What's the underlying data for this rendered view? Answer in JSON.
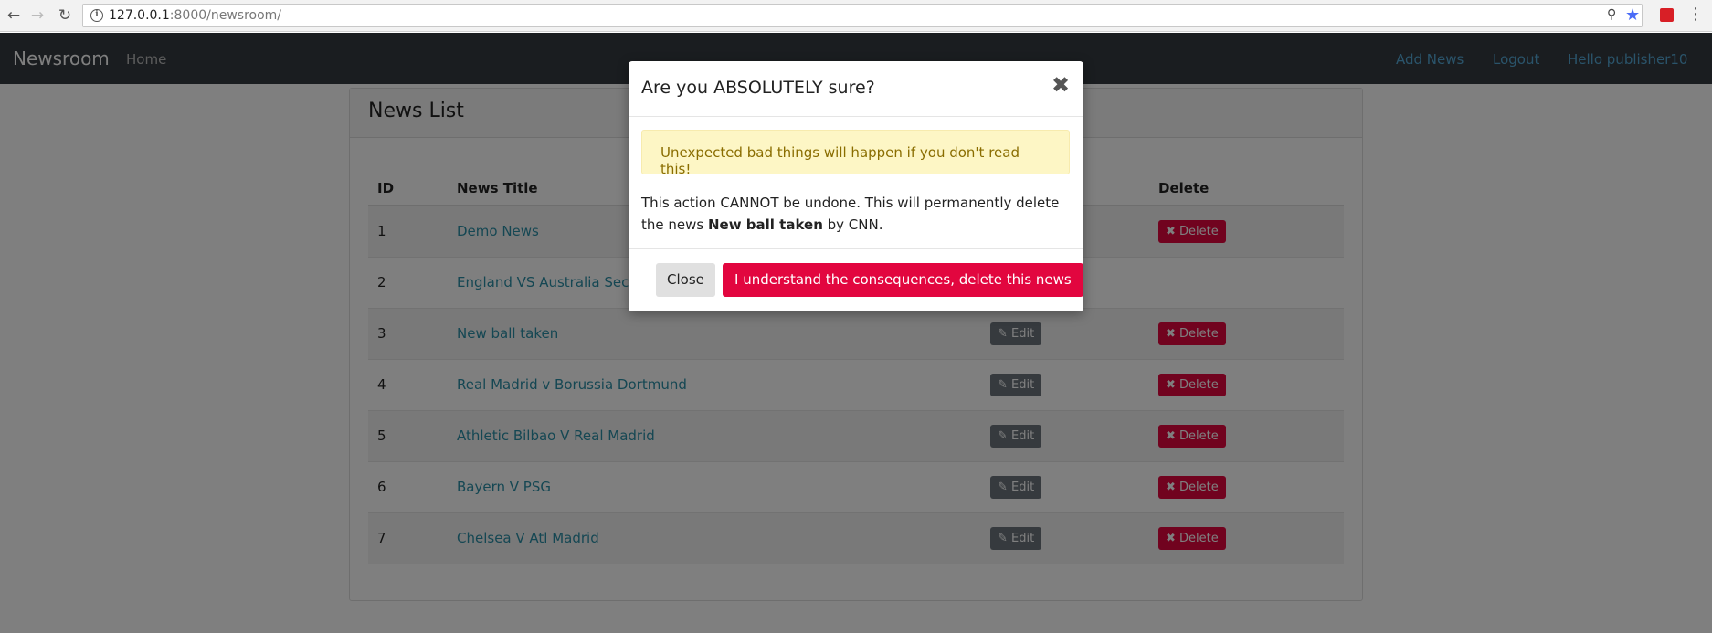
{
  "browser": {
    "url_host": "127.0.0.1",
    "url_rest": ":8000/newsroom/"
  },
  "navbar": {
    "brand": "Newsroom",
    "home": "Home",
    "add_news": "Add News",
    "logout": "Logout",
    "greeting": "Hello publisher10"
  },
  "card": {
    "title": "News List",
    "headers": {
      "id": "ID",
      "title": "News Title",
      "delete": "Delete"
    },
    "edit_label": "Edit",
    "delete_label": "Delete",
    "rows": [
      {
        "id": "1",
        "title": "Demo News"
      },
      {
        "id": "2",
        "title": "England VS Australia Seco"
      },
      {
        "id": "3",
        "title": "New ball taken"
      },
      {
        "id": "4",
        "title": "Real Madrid v Borussia Dortmund"
      },
      {
        "id": "5",
        "title": "Athletic Bilbao V Real Madrid"
      },
      {
        "id": "6",
        "title": "Bayern V PSG"
      },
      {
        "id": "7",
        "title": "Chelsea V Atl Madrid"
      }
    ]
  },
  "modal": {
    "title": "Are you ABSOLUTELY sure?",
    "alert": "Unexpected bad things will happen if you don't read this!",
    "text_before": "This action CANNOT be undone. This will permanently delete the news ",
    "news_title": "New ball taken",
    "text_after": " by CNN.",
    "close_label": "Close",
    "confirm_label": "I understand the consequences, delete this news"
  },
  "colors": {
    "navbar_bg": "#343a40",
    "danger": "#e2063f",
    "link": "#2a8ea6"
  },
  "icons": [
    "back-arrow-icon",
    "forward-arrow-icon",
    "reload-icon",
    "info-icon",
    "key-icon",
    "star-icon",
    "close-x-icon",
    "pencil-icon",
    "times-icon"
  ]
}
